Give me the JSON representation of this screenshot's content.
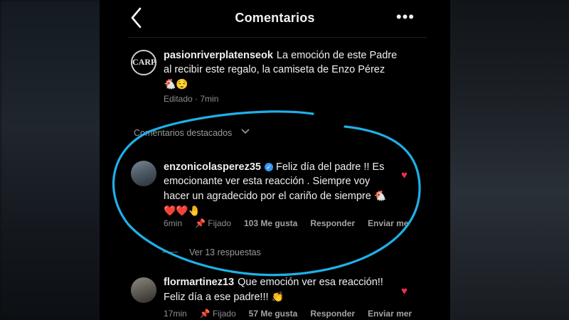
{
  "header": {
    "title": "Comentarios",
    "back_icon": "chevron-left-icon",
    "more_icon": "more-horizontal-icon",
    "more_glyph": "•••"
  },
  "post": {
    "username": "pasionriverplatenseok",
    "avatar_text": "CARP",
    "caption": "La emoción de este Padre al recibir este regalo, la camiseta de Enzo Pérez",
    "emojis": "🐔😌",
    "meta": "Editado · 7min"
  },
  "highlighted": {
    "label": "Comentarios destacados",
    "chevron": "⌄"
  },
  "comments": [
    {
      "username": "enzonicolasperez35",
      "verified": "✓",
      "text": "Feliz día del padre !! Es emocionante ver esta reacción . Siempre voy hacer un agradecido por el cariño de siempre",
      "emojis": "🐔❤️❤️🤚",
      "time": "6min",
      "pinned": "Fijado",
      "likes": "103 Me gusta",
      "reply": "Responder",
      "send": "Enviar me",
      "view_replies": "Ver 13 respuestas",
      "heart": "♥"
    },
    {
      "username": "flormartinez13",
      "text": "Que emoción ver esa reacción!! Feliz día a ese padre!!!",
      "emojis": "👏",
      "time": "17min",
      "pinned": "Fijado",
      "likes": "57 Me gusta",
      "reply": "Responder",
      "send": "Enviar mer",
      "heart": "♥"
    }
  ],
  "colors": {
    "background": "#000000",
    "accent_circle": "#1fb0e8",
    "heart": "#ed2f4a",
    "verified": "#3897f0"
  }
}
